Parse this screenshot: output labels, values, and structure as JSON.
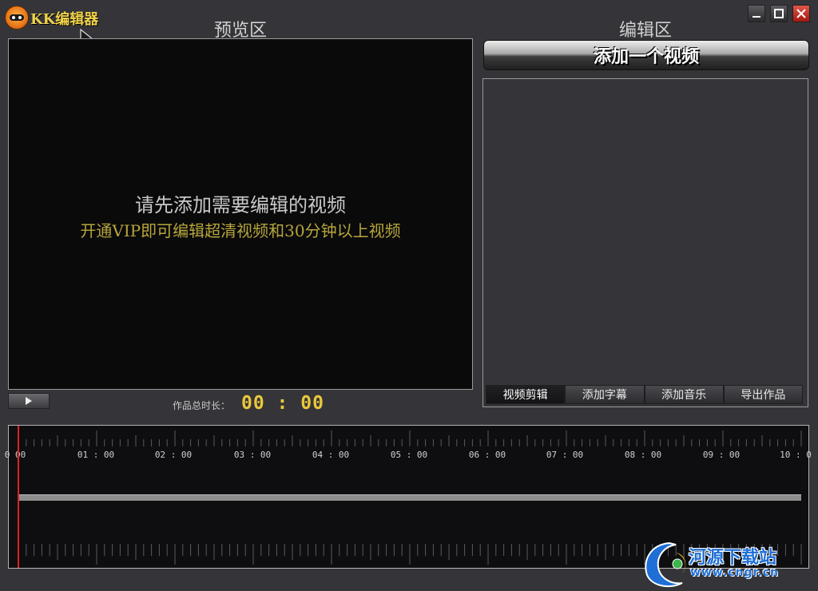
{
  "window": {
    "title": "KK编辑器",
    "buttons": [
      "minimize",
      "maximize",
      "close"
    ]
  },
  "preview": {
    "section_title": "预览区",
    "message": "请先添加需要编辑的视频",
    "vip_message": "开通VIP即可编辑超清视频和30分钟以上视频",
    "duration_label": "作品总时长：",
    "duration_value": "00 : 00"
  },
  "editor": {
    "section_title": "编辑区",
    "add_video_label": "添加一个视频",
    "tabs": [
      {
        "label": "视频剪辑",
        "active": true
      },
      {
        "label": "添加字幕",
        "active": false
      },
      {
        "label": "添加音乐",
        "active": false
      },
      {
        "label": "导出作品",
        "active": false
      }
    ]
  },
  "timeline": {
    "labels": [
      "0 00",
      "01 : 00",
      "02 : 00",
      "03 : 00",
      "04 : 00",
      "05 : 00",
      "06 : 00",
      "07 : 00",
      "08 : 00",
      "09 : 00",
      "10 : 0"
    ],
    "playhead": "00:00"
  },
  "watermark": {
    "text": "河源下载站",
    "url": "www.cngr.cn"
  },
  "colors": {
    "background": "#353539",
    "accent_yellow": "#e9c83a",
    "vip_text": "#b7a53c",
    "playhead": "#e02020",
    "close_button": "#c8281c"
  }
}
